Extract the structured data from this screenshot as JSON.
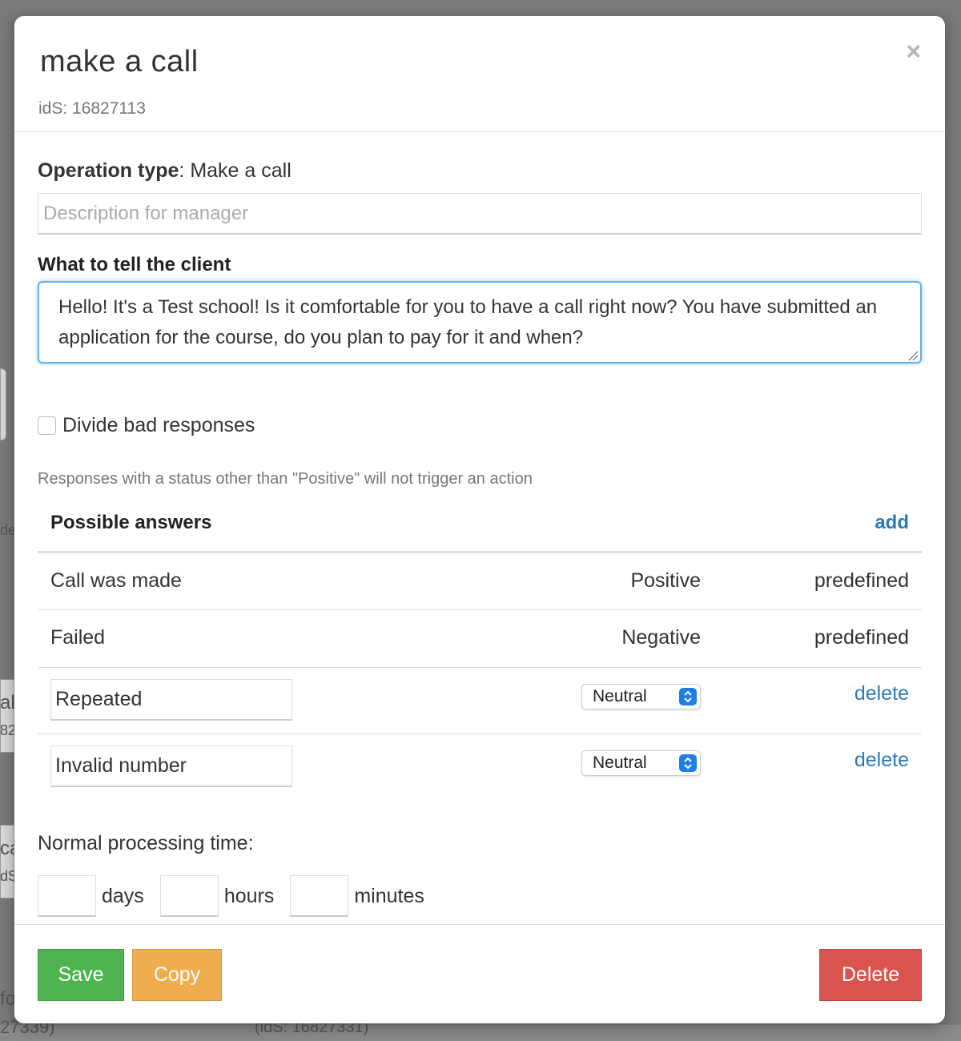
{
  "background": {
    "frag_de": "de",
    "frag_al": "al",
    "frag_82": "82",
    "frag_ca": "ca",
    "frag_ids": "dS",
    "frag_fo": "fo",
    "frag_27339": "27339)",
    "frag_bottom_ids": "(idS: 16827331)"
  },
  "modal": {
    "title": "make a call",
    "subtitle": "idS: 16827113",
    "close_glyph": "×"
  },
  "operation": {
    "label": "Operation type",
    "value": ": Make a call"
  },
  "description": {
    "placeholder": "Description for manager",
    "value": ""
  },
  "tell_client": {
    "label": "What to tell the client",
    "text": "Hello! It's a Test school! Is it comfortable for you to have a call right now? You have submitted an application for the course, do you plan to pay for it and when?"
  },
  "divide": {
    "label": "Divide bad responses",
    "checked": false
  },
  "hint": "Responses with a status other than \"Positive\" will not trigger an action",
  "answers": {
    "title": "Possible answers",
    "add_label": "add",
    "predefined": [
      {
        "name": "Call was made",
        "status": "Positive",
        "kind": "predefined"
      },
      {
        "name": "Failed",
        "status": "Negative",
        "kind": "predefined"
      }
    ],
    "custom": [
      {
        "name": "Repeated",
        "status": "Neutral",
        "delete_label": "delete"
      },
      {
        "name": "Invalid number",
        "status": "Neutral",
        "delete_label": "delete"
      }
    ]
  },
  "processing": {
    "label": "Normal processing time:",
    "days_unit": "days",
    "hours_unit": "hours",
    "minutes_unit": "minutes",
    "days": "",
    "hours": "",
    "minutes": ""
  },
  "footer": {
    "save_label": "Save",
    "copy_label": "Copy",
    "delete_label": "Delete"
  },
  "colors": {
    "save": "#4fb34f",
    "copy": "#f0ad4e",
    "delete": "#d9534f",
    "link": "#2a7ab8",
    "focus": "#66afe9",
    "select_arrow": "#1f7de6"
  },
  "icons": {
    "close": "close-icon",
    "select_arrow": "chevron-updown-icon",
    "resize": "resize-grip-icon"
  }
}
